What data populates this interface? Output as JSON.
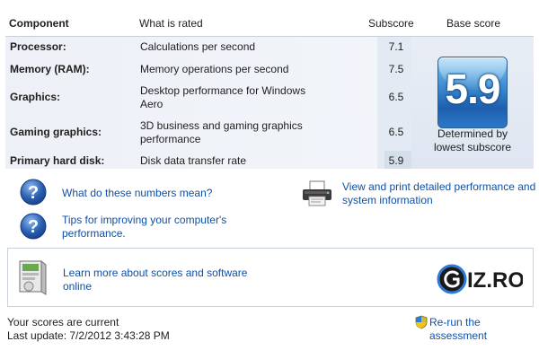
{
  "header": {
    "component": "Component",
    "what_is_rated": "What is rated",
    "subscore": "Subscore",
    "base_score": "Base score"
  },
  "rows": [
    {
      "component": "Processor:",
      "rated": "Calculations per second",
      "subscore": "7.1"
    },
    {
      "component": "Memory (RAM):",
      "rated": "Memory operations per second",
      "subscore": "7.5"
    },
    {
      "component": "Graphics:",
      "rated_line1": "Desktop performance for Windows",
      "rated_line2": "Aero",
      "subscore": "6.5"
    },
    {
      "component": "Gaming graphics:",
      "rated_line1": "3D business and gaming graphics",
      "rated_line2": "performance",
      "subscore": "6.5"
    },
    {
      "component": "Primary hard disk:",
      "rated": "Disk data transfer rate",
      "subscore": "5.9"
    }
  ],
  "base": {
    "score": "5.9",
    "caption_line1": "Determined by",
    "caption_line2": "lowest subscore"
  },
  "links": {
    "what_numbers": "What do these numbers mean?",
    "tips_line1": "Tips for improving your computer's",
    "tips_line2": "performance.",
    "view_print_line1": "View and print detailed performance and",
    "view_print_line2": "system information",
    "learn_line1": "Learn more about scores and software",
    "learn_line2": "online",
    "rerun": "Re-run the assessment"
  },
  "logo": {
    "text": "IZ.RO"
  },
  "footer": {
    "status": "Your scores are current",
    "last_update": "Last update: 7/2/2012 3:43:28 PM"
  },
  "colors": {
    "link": "#0f4fa8",
    "badge": "#1e5fae",
    "help_icon": "#2a5fb0"
  }
}
